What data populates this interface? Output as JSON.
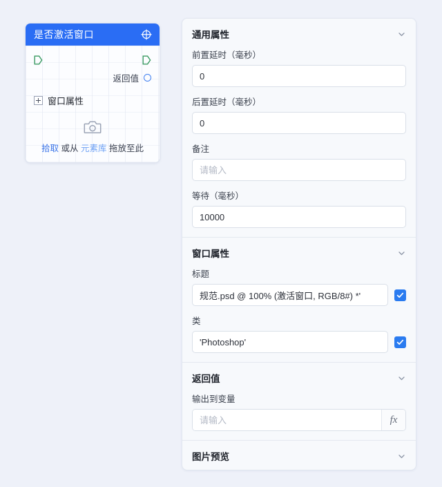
{
  "node_card": {
    "title": "是否激活窗口",
    "header_icon": "crosshair-icon",
    "input_port_icon": "flow-input-port-icon",
    "output_port_icon": "flow-output-port-icon",
    "return_label": "返回值",
    "return_port_icon": "return-value-port-icon",
    "window_prop_label": "窗口属性",
    "expander_icon": "plus-square-icon",
    "capture_icon": "camera-icon",
    "drop_hint": {
      "pick": "拾取",
      "middle": "或从",
      "library": "元素库",
      "tail": "拖放至此"
    }
  },
  "properties_panel": {
    "sections": [
      {
        "title": "通用属性",
        "chevron_icon": "chevron-down-icon",
        "fields": [
          {
            "label": "前置延时（毫秒）",
            "value": "0",
            "placeholder": ""
          },
          {
            "label": "后置延时（毫秒）",
            "value": "0",
            "placeholder": ""
          },
          {
            "label": "备注",
            "value": "",
            "placeholder": "请输入"
          },
          {
            "label": "等待（毫秒）",
            "value": "10000",
            "placeholder": ""
          }
        ]
      },
      {
        "title": "窗口属性",
        "chevron_icon": "chevron-down-icon",
        "fields": [
          {
            "label": "标题",
            "value": "规范.psd @ 100% (激活窗口, RGB/8#) *'",
            "placeholder": "",
            "checkbox": true,
            "checkbox_icon": "check-icon"
          },
          {
            "label": "类",
            "value": "'Photoshop'",
            "placeholder": "",
            "checkbox": true,
            "checkbox_icon": "check-icon"
          }
        ]
      },
      {
        "title": "返回值",
        "chevron_icon": "chevron-down-icon",
        "fields": [
          {
            "label": "输出到变量",
            "value": "",
            "placeholder": "请输入",
            "fx_label": "fx",
            "fx_icon": "fx-function-icon"
          }
        ]
      },
      {
        "title": "图片预览",
        "chevron_icon": "chevron-down-icon",
        "fields": []
      }
    ]
  },
  "colors": {
    "background": "#eef1f9",
    "node_header": "#2a6df4",
    "accent_checkbox": "#2a7bf0",
    "flow_port": "#3a9a62",
    "return_port": "#3f7ff0",
    "link_primary": "#3a74e8",
    "link_secondary": "#6fa2f5"
  }
}
